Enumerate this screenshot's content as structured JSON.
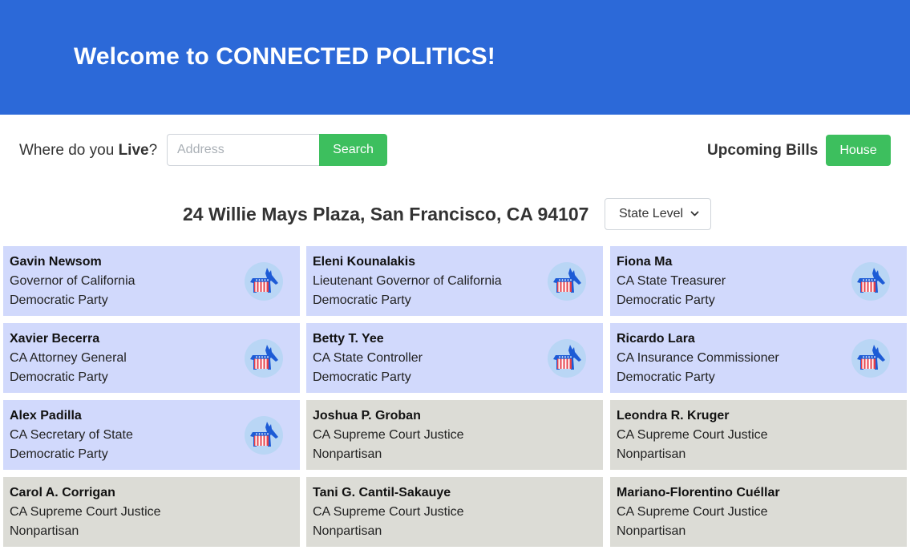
{
  "header": {
    "title": "Welcome to CONNECTED POLITICS!"
  },
  "search": {
    "prompt_prefix": "Where do you ",
    "prompt_bold": "Live",
    "prompt_suffix": "?",
    "placeholder": "Address",
    "value": "",
    "button_label": "Search"
  },
  "bills": {
    "label": "Upcoming Bills",
    "button_label": "House"
  },
  "location": {
    "address": "24 Willie Mays Plaza, San Francisco, CA 94107"
  },
  "level_select": {
    "selected": "State Level"
  },
  "colors": {
    "header_bg": "#2c69d8",
    "button_green": "#3dbf5e",
    "democratic_card": "#d1d9fc",
    "nonpartisan_card": "#dcdcd6"
  },
  "officials": [
    {
      "name": "Gavin Newsom",
      "office": "Governor of California",
      "party": "Democratic Party",
      "icon": "democratic-donkey-icon"
    },
    {
      "name": "Eleni Kounalakis",
      "office": "Lieutenant Governor of California",
      "party": "Democratic Party",
      "icon": "democratic-donkey-icon"
    },
    {
      "name": "Fiona Ma",
      "office": "CA State Treasurer",
      "party": "Democratic Party",
      "icon": "democratic-donkey-icon"
    },
    {
      "name": "Xavier Becerra",
      "office": "CA Attorney General",
      "party": "Democratic Party",
      "icon": "democratic-donkey-icon"
    },
    {
      "name": "Betty T. Yee",
      "office": "CA State Controller",
      "party": "Democratic Party",
      "icon": "democratic-donkey-icon"
    },
    {
      "name": "Ricardo Lara",
      "office": "CA Insurance Commissioner",
      "party": "Democratic Party",
      "icon": "democratic-donkey-icon"
    },
    {
      "name": "Alex Padilla",
      "office": "CA Secretary of State",
      "party": "Democratic Party",
      "icon": "democratic-donkey-icon"
    },
    {
      "name": "Joshua P. Groban",
      "office": "CA Supreme Court Justice",
      "party": "Nonpartisan",
      "icon": ""
    },
    {
      "name": "Leondra R. Kruger",
      "office": "CA Supreme Court Justice",
      "party": "Nonpartisan",
      "icon": ""
    },
    {
      "name": "Carol A. Corrigan",
      "office": "CA Supreme Court Justice",
      "party": "Nonpartisan",
      "icon": ""
    },
    {
      "name": "Tani G. Cantil-Sakauye",
      "office": "CA Supreme Court Justice",
      "party": "Nonpartisan",
      "icon": ""
    },
    {
      "name": "Mariano-Florentino Cuéllar",
      "office": "CA Supreme Court Justice",
      "party": "Nonpartisan",
      "icon": ""
    }
  ]
}
